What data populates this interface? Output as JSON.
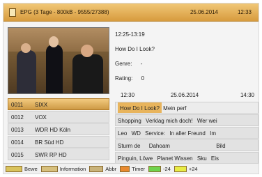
{
  "header": {
    "title": "EPG (3 Tage - 800kB - 9555/27388)",
    "date": "25.06.2014",
    "time": "12:33"
  },
  "program_info": {
    "time_range": "12:25-13:19",
    "title": "How Do I Look?",
    "genre_label": "Genre:",
    "genre_value": "-",
    "rating_label": "Rating:",
    "rating_value": "0"
  },
  "timeline": {
    "start": "12:30",
    "date": "25.06.2014",
    "end": "14:30"
  },
  "channels": [
    {
      "num": "0011",
      "name": "SIXX",
      "selected": true
    },
    {
      "num": "0012",
      "name": "VOX",
      "selected": false
    },
    {
      "num": "0013",
      "name": "WDR HD Köln",
      "selected": false
    },
    {
      "num": "0014",
      "name": "BR Süd HD",
      "selected": false
    },
    {
      "num": "0015",
      "name": "SWR RP HD",
      "selected": false
    }
  ],
  "epg_rows": [
    {
      "cells": [
        "How Do I Look?",
        "Mein perf"
      ],
      "highlight": 0
    },
    {
      "cells": [
        "Shopping",
        "Verklag mich doch!",
        "Wer wei"
      ]
    },
    {
      "cells": [
        "Leo",
        "WD",
        "Service:",
        "In aller Freund",
        "Im"
      ]
    },
    {
      "cells": [
        "Sturm de",
        "Dahoam",
        "Bild"
      ]
    },
    {
      "cells": [
        "Pinguin, Löwe",
        "Planet Wissen",
        "Sku",
        "Eis"
      ]
    }
  ],
  "footer": {
    "btn1_label": "Bewe",
    "btn2_label": "Information",
    "btn3_label": "Abbr",
    "btn4_label": "Timer",
    "btn5_label": "-24",
    "btn6_label": "+24"
  }
}
